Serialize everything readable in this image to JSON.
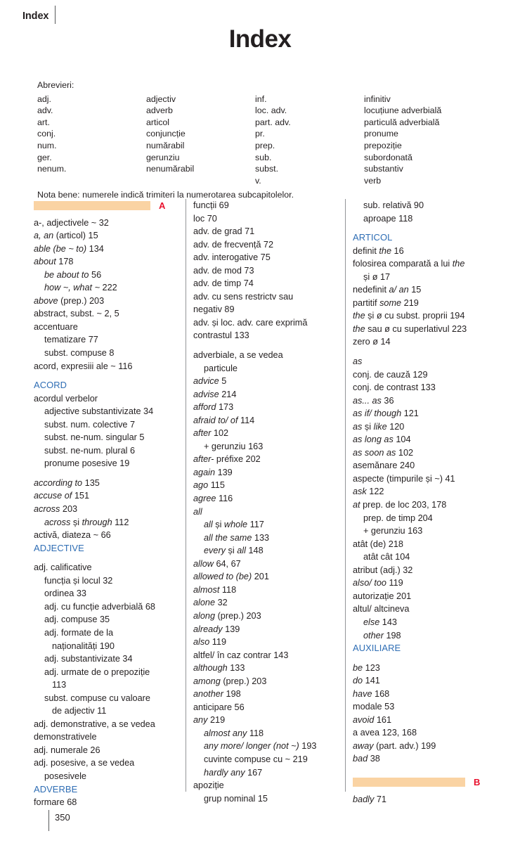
{
  "running_head": {
    "label": "Index"
  },
  "title": "Index",
  "abbreviations": {
    "intro": "Abrevieri:",
    "rows": [
      {
        "abbr1": "adj.",
        "full1": "adjectiv",
        "abbr2": "inf.",
        "full2": "infinitiv"
      },
      {
        "abbr1": "adv.",
        "full1": "adverb",
        "abbr2": "loc. adv.",
        "full2": "locuțiune adverbială"
      },
      {
        "abbr1": "art.",
        "full1": "articol",
        "abbr2": "part. adv.",
        "full2": "particulă adverbială"
      },
      {
        "abbr1": "conj.",
        "full1": "conjuncție",
        "abbr2": "pr.",
        "full2": "pronume"
      },
      {
        "abbr1": "num.",
        "full1": "numărabil",
        "abbr2": "prep.",
        "full2": "prepoziție"
      },
      {
        "abbr1": "ger.",
        "full1": "gerunziu",
        "abbr2": "sub.",
        "full2": "subordonată"
      },
      {
        "abbr1": "nenum.",
        "full1": "nenumărabil",
        "abbr2": "subst.",
        "full2": "substantiv"
      },
      {
        "abbr1": "",
        "full1": "",
        "abbr2": "v.",
        "full2": "verb"
      }
    ],
    "note": "Nota bene: numerele indică trimiteri la numerotarea subcapitolelor."
  },
  "markers": {
    "a": "A",
    "b": "B",
    "bar_color": "#fad3a3",
    "letter_color": "#e8112d"
  },
  "colors": {
    "section_head": "#2e6db4",
    "text": "#231f20",
    "rule": "#939598"
  },
  "column1": [
    {
      "level": 1,
      "text": "a-, adjectivele ~ 32"
    },
    {
      "level": 1,
      "text": "a, an (articol) 15",
      "italic_prefix": "a, an"
    },
    {
      "level": 1,
      "text": "able (be ~ to) 134",
      "italic_prefix": "able (be ~ to)"
    },
    {
      "level": 1,
      "text": "about 178",
      "italic_prefix": "about"
    },
    {
      "level": 2,
      "text": "be about to 56",
      "italic_prefix": "be about to"
    },
    {
      "level": 2,
      "text": "how ~, what ~ 222",
      "italic_prefix": "how ~, what ~"
    },
    {
      "level": 1,
      "text": "above (prep.) 203",
      "italic_prefix": "above"
    },
    {
      "level": 1,
      "text": "abstract, subst. ~ 2, 5"
    },
    {
      "level": 1,
      "text": "accentuare"
    },
    {
      "level": 2,
      "text": "tematizare 77"
    },
    {
      "level": 2,
      "text": "subst. compuse 8"
    },
    {
      "level": 1,
      "text": "acord, expresiii ale ~ 116"
    },
    {
      "level": 0,
      "text": "ACORD",
      "type": "section"
    },
    {
      "level": 1,
      "text": "acordul verbelor"
    },
    {
      "level": 2,
      "text": "adjective substantivizate 34"
    },
    {
      "level": 2,
      "text": "subst. num. colective 7"
    },
    {
      "level": 2,
      "text": "subst. ne-num. singular 5"
    },
    {
      "level": 2,
      "text": "subst. ne-num. plural 6"
    },
    {
      "level": 2,
      "text": "pronume posesive 19"
    },
    {
      "level": 1,
      "text": "according to 135",
      "italic_prefix": "according to"
    },
    {
      "level": 1,
      "text": "accuse of 151",
      "italic_prefix": "accuse of"
    },
    {
      "level": 1,
      "text": "across 203",
      "italic_prefix": "across"
    },
    {
      "level": 2,
      "text": "across și through 112"
    },
    {
      "level": 1,
      "text": "activă, diateza ~ 66"
    },
    {
      "level": 0,
      "text": "ADJECTIVE",
      "type": "section"
    },
    {
      "level": 1,
      "text": "adj. calificative"
    },
    {
      "level": 2,
      "text": "funcția și locul 32"
    },
    {
      "level": 2,
      "text": "ordinea 33"
    },
    {
      "level": 2,
      "text": "adj. cu funcție adverbială 68"
    },
    {
      "level": 2,
      "text": "adj. compuse 35"
    },
    {
      "level": 2,
      "text": "adj. formate de la"
    },
    {
      "level": 3,
      "text": "naționalități 190"
    },
    {
      "level": 2,
      "text": "adj. substantivizate 34"
    },
    {
      "level": 2,
      "text": "adj. urmate de o prepoziție"
    },
    {
      "level": 3,
      "text": "113"
    },
    {
      "level": 2,
      "text": "subst. compuse cu valoare"
    },
    {
      "level": 3,
      "text": "de adjectiv 11"
    },
    {
      "level": 1,
      "text": "adj. demonstrative, a se vedea"
    },
    {
      "level": 1,
      "text": "demonstrativele"
    },
    {
      "level": 1,
      "text": "adj. numerale 26"
    },
    {
      "level": 1,
      "text": "adj. posesive, a se vedea"
    },
    {
      "level": 2,
      "text": "posesivele"
    },
    {
      "level": 0,
      "text": "ADVERBE",
      "type": "section"
    },
    {
      "level": 1,
      "text": "formare 68"
    }
  ],
  "column2": [
    {
      "level": 1,
      "text": "funcții 69"
    },
    {
      "level": 1,
      "text": "loc 70"
    },
    {
      "level": 1,
      "text": "adv. de grad 71"
    },
    {
      "level": 1,
      "text": "adv. de frecvență 72"
    },
    {
      "level": 1,
      "text": "adv. interogative 75"
    },
    {
      "level": 1,
      "text": "adv. de mod 73"
    },
    {
      "level": 1,
      "text": "adv. de timp 74"
    },
    {
      "level": 1,
      "text": "adv. cu sens restrictv sau"
    },
    {
      "level": 1,
      "text": "negativ 89"
    },
    {
      "level": 1,
      "text": "adv. și loc. adv. care exprimă"
    },
    {
      "level": 1,
      "text": "contrastul 133"
    },
    {
      "level": 1,
      "text": "adverbiale, a se vedea"
    },
    {
      "level": 2,
      "text": "particule"
    },
    {
      "level": 1,
      "text": "advice 5",
      "italic_prefix": "advice"
    },
    {
      "level": 1,
      "text": "advise 214",
      "italic_prefix": "advise"
    },
    {
      "level": 1,
      "text": "afford 173",
      "italic_prefix": "afford"
    },
    {
      "level": 1,
      "text": "afraid to/ of 114",
      "italic_prefix": "afraid to/ of"
    },
    {
      "level": 1,
      "text": "after 102",
      "italic_prefix": "after"
    },
    {
      "level": 2,
      "text": "+ gerunziu 163"
    },
    {
      "level": 1,
      "text": "after- préfixe 202",
      "italic_prefix": "after-"
    },
    {
      "level": 1,
      "text": "again 139",
      "italic_prefix": "again"
    },
    {
      "level": 1,
      "text": "ago 115",
      "italic_prefix": "ago"
    },
    {
      "level": 1,
      "text": "agree 116",
      "italic_prefix": "agree"
    },
    {
      "level": 1,
      "text": "all",
      "italic_prefix": "all"
    },
    {
      "level": 2,
      "text": "all și whole 117"
    },
    {
      "level": 2,
      "text": "all the same 133",
      "italic_prefix": "all the same"
    },
    {
      "level": 2,
      "text": "every și all 148"
    },
    {
      "level": 1,
      "text": "allow 64, 67",
      "italic_prefix": "allow"
    },
    {
      "level": 1,
      "text": "allowed to (be) 201",
      "italic_prefix": "allowed to (be)"
    },
    {
      "level": 1,
      "text": "almost 118",
      "italic_prefix": "almost"
    },
    {
      "level": 1,
      "text": "alone 32",
      "italic_prefix": "alone"
    },
    {
      "level": 1,
      "text": "along (prep.) 203",
      "italic_prefix": "along"
    },
    {
      "level": 1,
      "text": "already 139",
      "italic_prefix": "already"
    },
    {
      "level": 1,
      "text": "also 119",
      "italic_prefix": "also"
    },
    {
      "level": 1,
      "text": "altfel/ în caz contrar 143"
    },
    {
      "level": 1,
      "text": "although 133",
      "italic_prefix": "although"
    },
    {
      "level": 1,
      "text": "among (prep.) 203",
      "italic_prefix": "among"
    },
    {
      "level": 1,
      "text": "another 198",
      "italic_prefix": "another"
    },
    {
      "level": 1,
      "text": "anticipare 56"
    },
    {
      "level": 1,
      "text": "any 219",
      "italic_prefix": "any"
    },
    {
      "level": 2,
      "text": "almost any 118",
      "italic_prefix": "almost any"
    },
    {
      "level": 2,
      "text": "any more/ longer (not ~) 193",
      "italic_prefix": "any more/ longer (not ~)"
    },
    {
      "level": 2,
      "text": "cuvinte compuse cu ~ 219"
    },
    {
      "level": 2,
      "text": "hardly any 167",
      "italic_prefix": "hardly any"
    },
    {
      "level": 1,
      "text": "apoziție"
    },
    {
      "level": 2,
      "text": "grup nominal 15"
    }
  ],
  "column3": [
    {
      "level": 2,
      "text": "sub. relativă 90"
    },
    {
      "level": 2,
      "text": "aproape 118"
    },
    {
      "level": 0,
      "text": "ARTICOL",
      "type": "section"
    },
    {
      "level": 1,
      "text": "definit the 16"
    },
    {
      "level": 1,
      "text": "folosirea comparată a lui the"
    },
    {
      "level": 2,
      "text": "și ø 17"
    },
    {
      "level": 1,
      "text": "nedefinit a/ an 15"
    },
    {
      "level": 1,
      "text": "partitif some 219"
    },
    {
      "level": 1,
      "text": "the și ø cu subst. proprii 194"
    },
    {
      "level": 1,
      "text": "the sau ø cu superlativul 223"
    },
    {
      "level": 1,
      "text": "zero ø 14"
    },
    {
      "level": 1,
      "text": "as",
      "italic_prefix": "as"
    },
    {
      "level": 1,
      "text": "conj. de cauză 129"
    },
    {
      "level": 1,
      "text": "conj. de contrast 133"
    },
    {
      "level": 1,
      "text": "as... as 36",
      "italic_prefix": "as... as"
    },
    {
      "level": 1,
      "text": "as if/ though 121",
      "italic_prefix": "as if/ though"
    },
    {
      "level": 1,
      "text": "as și like 120"
    },
    {
      "level": 1,
      "text": "as long as 104",
      "italic_prefix": "as long as"
    },
    {
      "level": 1,
      "text": "as soon as 102",
      "italic_prefix": "as soon as"
    },
    {
      "level": 1,
      "text": "asemănare 240"
    },
    {
      "level": 1,
      "text": "aspecte (timpurile și ~) 41"
    },
    {
      "level": 1,
      "text": "ask 122",
      "italic_prefix": "ask"
    },
    {
      "level": 1,
      "text": "at prep. de loc 203, 178"
    },
    {
      "level": 2,
      "text": "prep. de timp 204"
    },
    {
      "level": 2,
      "text": "+ gerunziu 163"
    },
    {
      "level": 1,
      "text": "atât (de) 218"
    },
    {
      "level": 2,
      "text": "atât cât 104"
    },
    {
      "level": 1,
      "text": "atribut (adj.) 32"
    },
    {
      "level": 1,
      "text": "also/ too 119",
      "italic_prefix": "also/ too"
    },
    {
      "level": 1,
      "text": "autorizație 201"
    },
    {
      "level": 1,
      "text": "altul/ altcineva"
    },
    {
      "level": 2,
      "text": "else 143",
      "italic_prefix": "else"
    },
    {
      "level": 2,
      "text": "other 198",
      "italic_prefix": "other"
    },
    {
      "level": 0,
      "text": "AUXILIARE",
      "type": "section"
    },
    {
      "level": 1,
      "text": "be 123",
      "italic_prefix": "be"
    },
    {
      "level": 1,
      "text": "do 141",
      "italic_prefix": "do"
    },
    {
      "level": 1,
      "text": "have 168",
      "italic_prefix": "have"
    },
    {
      "level": 1,
      "text": "modale 53"
    },
    {
      "level": 1,
      "text": "avoid 161",
      "italic_prefix": "avoid"
    },
    {
      "level": 1,
      "text": "a avea 123, 168"
    },
    {
      "level": 1,
      "text": "away (part. adv.) 199",
      "italic_prefix": "away"
    },
    {
      "level": 1,
      "text": "bad 38",
      "italic_prefix": "bad"
    },
    {
      "level": 1,
      "text": "badly 71",
      "italic_prefix": "badly"
    }
  ],
  "footer": {
    "page_number": "350"
  }
}
